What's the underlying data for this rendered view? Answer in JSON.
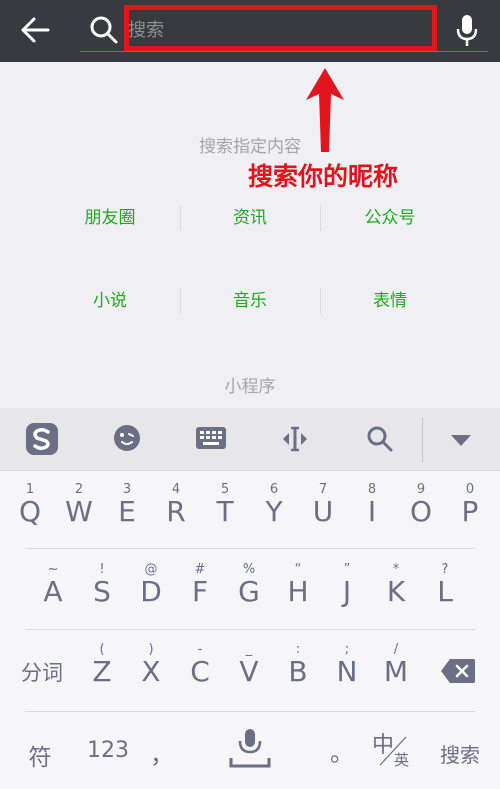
{
  "search": {
    "placeholder": "搜索"
  },
  "annotation": {
    "text": "搜索你的昵称"
  },
  "panel": {
    "title": "搜索指定内容",
    "row1": [
      "朋友圈",
      "资讯",
      "公众号"
    ],
    "row2": [
      "小说",
      "音乐",
      "表情"
    ],
    "mini_program": "小程序"
  },
  "keyboard": {
    "row1": [
      {
        "num": "1",
        "key": "Q"
      },
      {
        "num": "2",
        "key": "W"
      },
      {
        "num": "3",
        "key": "E"
      },
      {
        "num": "4",
        "key": "R"
      },
      {
        "num": "5",
        "key": "T"
      },
      {
        "num": "6",
        "key": "Y"
      },
      {
        "num": "7",
        "key": "U"
      },
      {
        "num": "8",
        "key": "I"
      },
      {
        "num": "9",
        "key": "O"
      },
      {
        "num": "0",
        "key": "P"
      }
    ],
    "row2": [
      {
        "sym": "~",
        "key": "A"
      },
      {
        "sym": "!",
        "key": "S"
      },
      {
        "sym": "@",
        "key": "D"
      },
      {
        "sym": "#",
        "key": "F"
      },
      {
        "sym": "%",
        "key": "G"
      },
      {
        "sym": "“",
        "key": "H"
      },
      {
        "sym": "”",
        "key": "J"
      },
      {
        "sym": "*",
        "key": "K"
      },
      {
        "sym": "?",
        "key": "L"
      }
    ],
    "row3": [
      {
        "sym": "(",
        "key": "Z"
      },
      {
        "sym": ")",
        "key": "X"
      },
      {
        "sym": "-",
        "key": "C"
      },
      {
        "sym": "_",
        "key": "V"
      },
      {
        "sym": ":",
        "key": "B"
      },
      {
        "sym": ";",
        "key": "N"
      },
      {
        "sym": "/",
        "key": "M"
      }
    ],
    "segment_label": "分词",
    "symbol_label": "符",
    "numbers_label": "123",
    "comma": "，",
    "period": "。",
    "lang_main": "中",
    "lang_sub": "英",
    "search_label": "搜索"
  },
  "colors": {
    "accent": "#1aad19",
    "annotation": "#e0161c",
    "key_text": "#6b6f86"
  }
}
